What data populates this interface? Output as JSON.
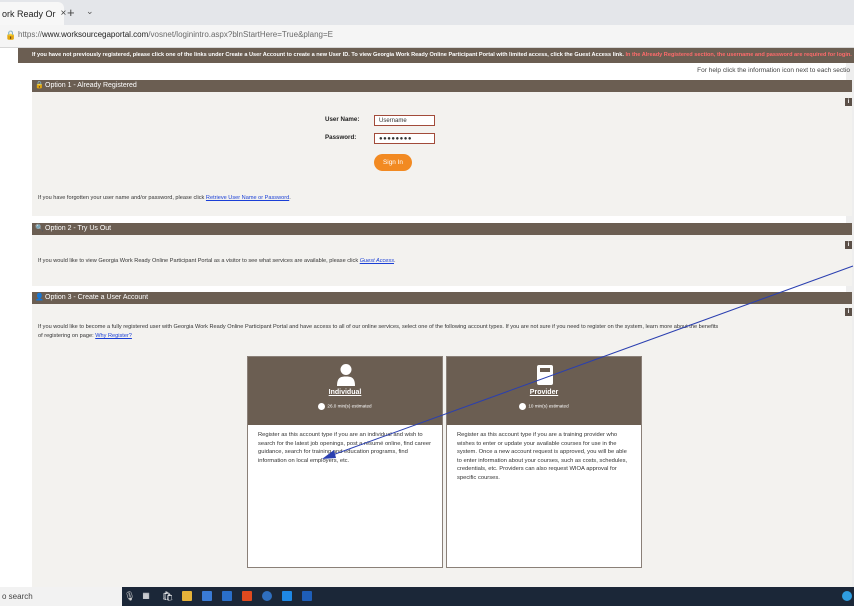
{
  "browser": {
    "tab_title": "ork Ready Or",
    "tab_close": "×",
    "new_tab": "+",
    "tab_dropdown": "⌄",
    "url_prefix": "https://",
    "url_domain": "www.worksourcegaportal.com",
    "url_path": "/vosnet/loginintro.aspx?blnStartHere=True&plang=E"
  },
  "notice": {
    "text_main": "If you have not previously registered, please click one of the links under Create a User Account to create a new User ID. To view Georgia Work Ready Online Participant Portal with limited access, click the Guest Access link.",
    "text_red": "In the Already Registered section, the username and password are required for login."
  },
  "help_text": "For help click the information icon next to each sectio",
  "option1": {
    "title": "Option 1 - Already Registered",
    "username_label": "User Name:",
    "username_value": "Username",
    "password_label": "Password:",
    "password_value": "●●●●●●●●",
    "signin_label": "Sign In",
    "forgot_text": "If you have forgotten your user name and/or password, please click",
    "forgot_link": "Retrieve User Name or Password",
    "forgot_end": "."
  },
  "option2": {
    "title": "Option 2 - Try Us Out",
    "text": "If you would like to view Georgia Work Ready Online Participant Portal as a visitor to see what services are available, please click",
    "link": "Guest Access",
    "end": "."
  },
  "option3": {
    "title": "Option 3 - Create a User Account",
    "text_line1": "If you would like to become a fully registered user with Georgia Work Ready Online Participant Portal and have access to all of our online services, select one of the following account types. If you are not sure if you need to register on the system, learn more about the benefits",
    "text_line2": "of registering on page:",
    "link": "Why Register?",
    "cards": [
      {
        "title": "Individual",
        "estimate": "26.0 min(s) estimated",
        "desc": "Register as this account type if you are an individual and wish to search for the latest job openings, post a résumé online, find career guidance, search for training and education programs, find information on local employers, etc."
      },
      {
        "title": "Provider",
        "estimate": "10 min(s) estimated",
        "desc": "Register as this account type if you are a training provider who wishes to enter or update your available courses for use in the system. Once a new account request is approved, you will be able to enter information about your courses, such as costs, schedules, credentials, etc. Providers can also request WIOA approval for specific courses."
      }
    ]
  },
  "taskbar": {
    "search": "o search"
  },
  "colors": {
    "header_brown": "#6b5e52",
    "accent_orange": "#f28a22",
    "link_blue": "#1a3fd6",
    "taskbar": "#1b2738",
    "annotation_line": "#2a3fb0"
  }
}
